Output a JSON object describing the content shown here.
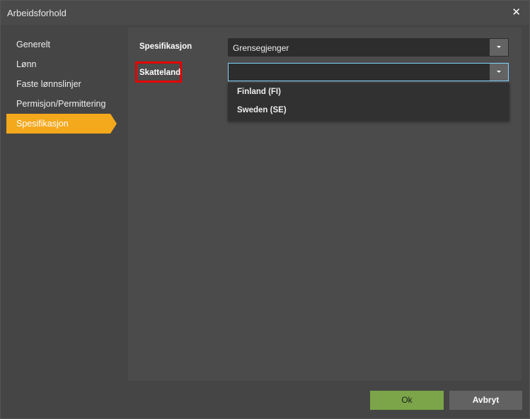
{
  "window": {
    "title": "Arbeidsforhold",
    "close_icon": "close-icon"
  },
  "nav": {
    "items": [
      {
        "label": "Generelt",
        "active": false
      },
      {
        "label": "Lønn",
        "active": false
      },
      {
        "label": "Faste lønnslinjer",
        "active": false
      },
      {
        "label": "Permisjon/Permittering",
        "active": false
      },
      {
        "label": "Spesifikasjon",
        "active": true
      }
    ]
  },
  "form": {
    "spesifikasjon": {
      "label": "Spesifikasjon",
      "value": "Grensegjenger"
    },
    "skatteland": {
      "label": "Skatteland",
      "value": "",
      "options": [
        "Finland (FI)",
        "Sweden (SE)"
      ]
    }
  },
  "footer": {
    "ok_label": "Ok",
    "cancel_label": "Avbryt"
  },
  "colors": {
    "accent": "#f4a81b",
    "ok_button": "#7ba548",
    "highlight": "#e60000",
    "focus_border": "#7fd3ff"
  }
}
